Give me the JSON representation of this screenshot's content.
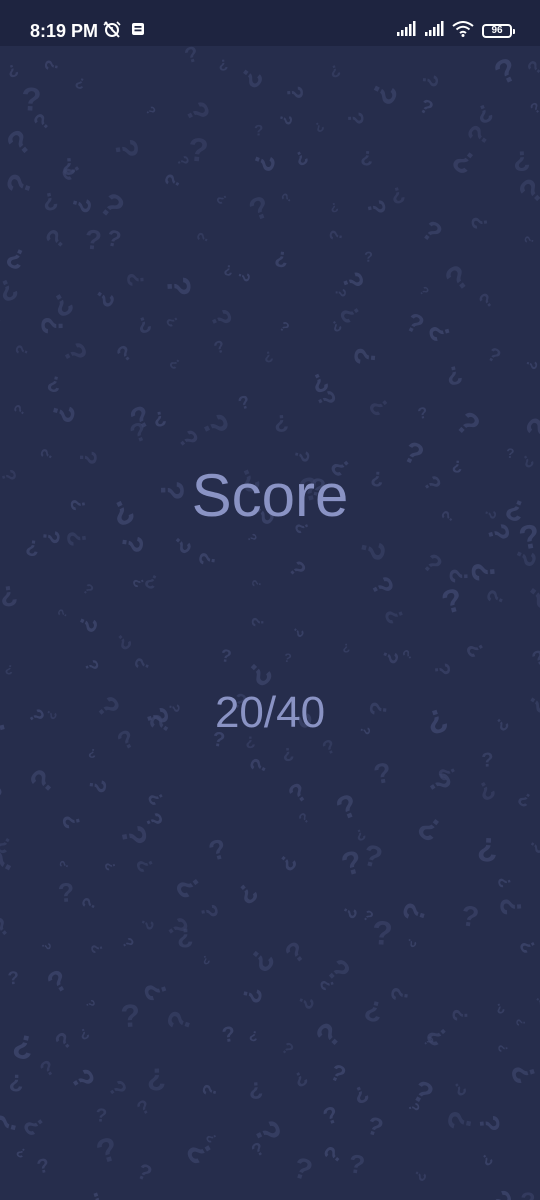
{
  "status_bar": {
    "time": "8:19 PM",
    "battery_level": "96",
    "icons": [
      "alarm-off-icon",
      "notification-icon",
      "signal-icon",
      "signal-icon",
      "wifi-icon",
      "battery-icon"
    ]
  },
  "score": {
    "title": "Score",
    "value": "20/40"
  },
  "colors": {
    "background": "#262d4c",
    "status_bar": "#1e2440",
    "text": "#8a93c4",
    "pattern": "#3c446a"
  }
}
